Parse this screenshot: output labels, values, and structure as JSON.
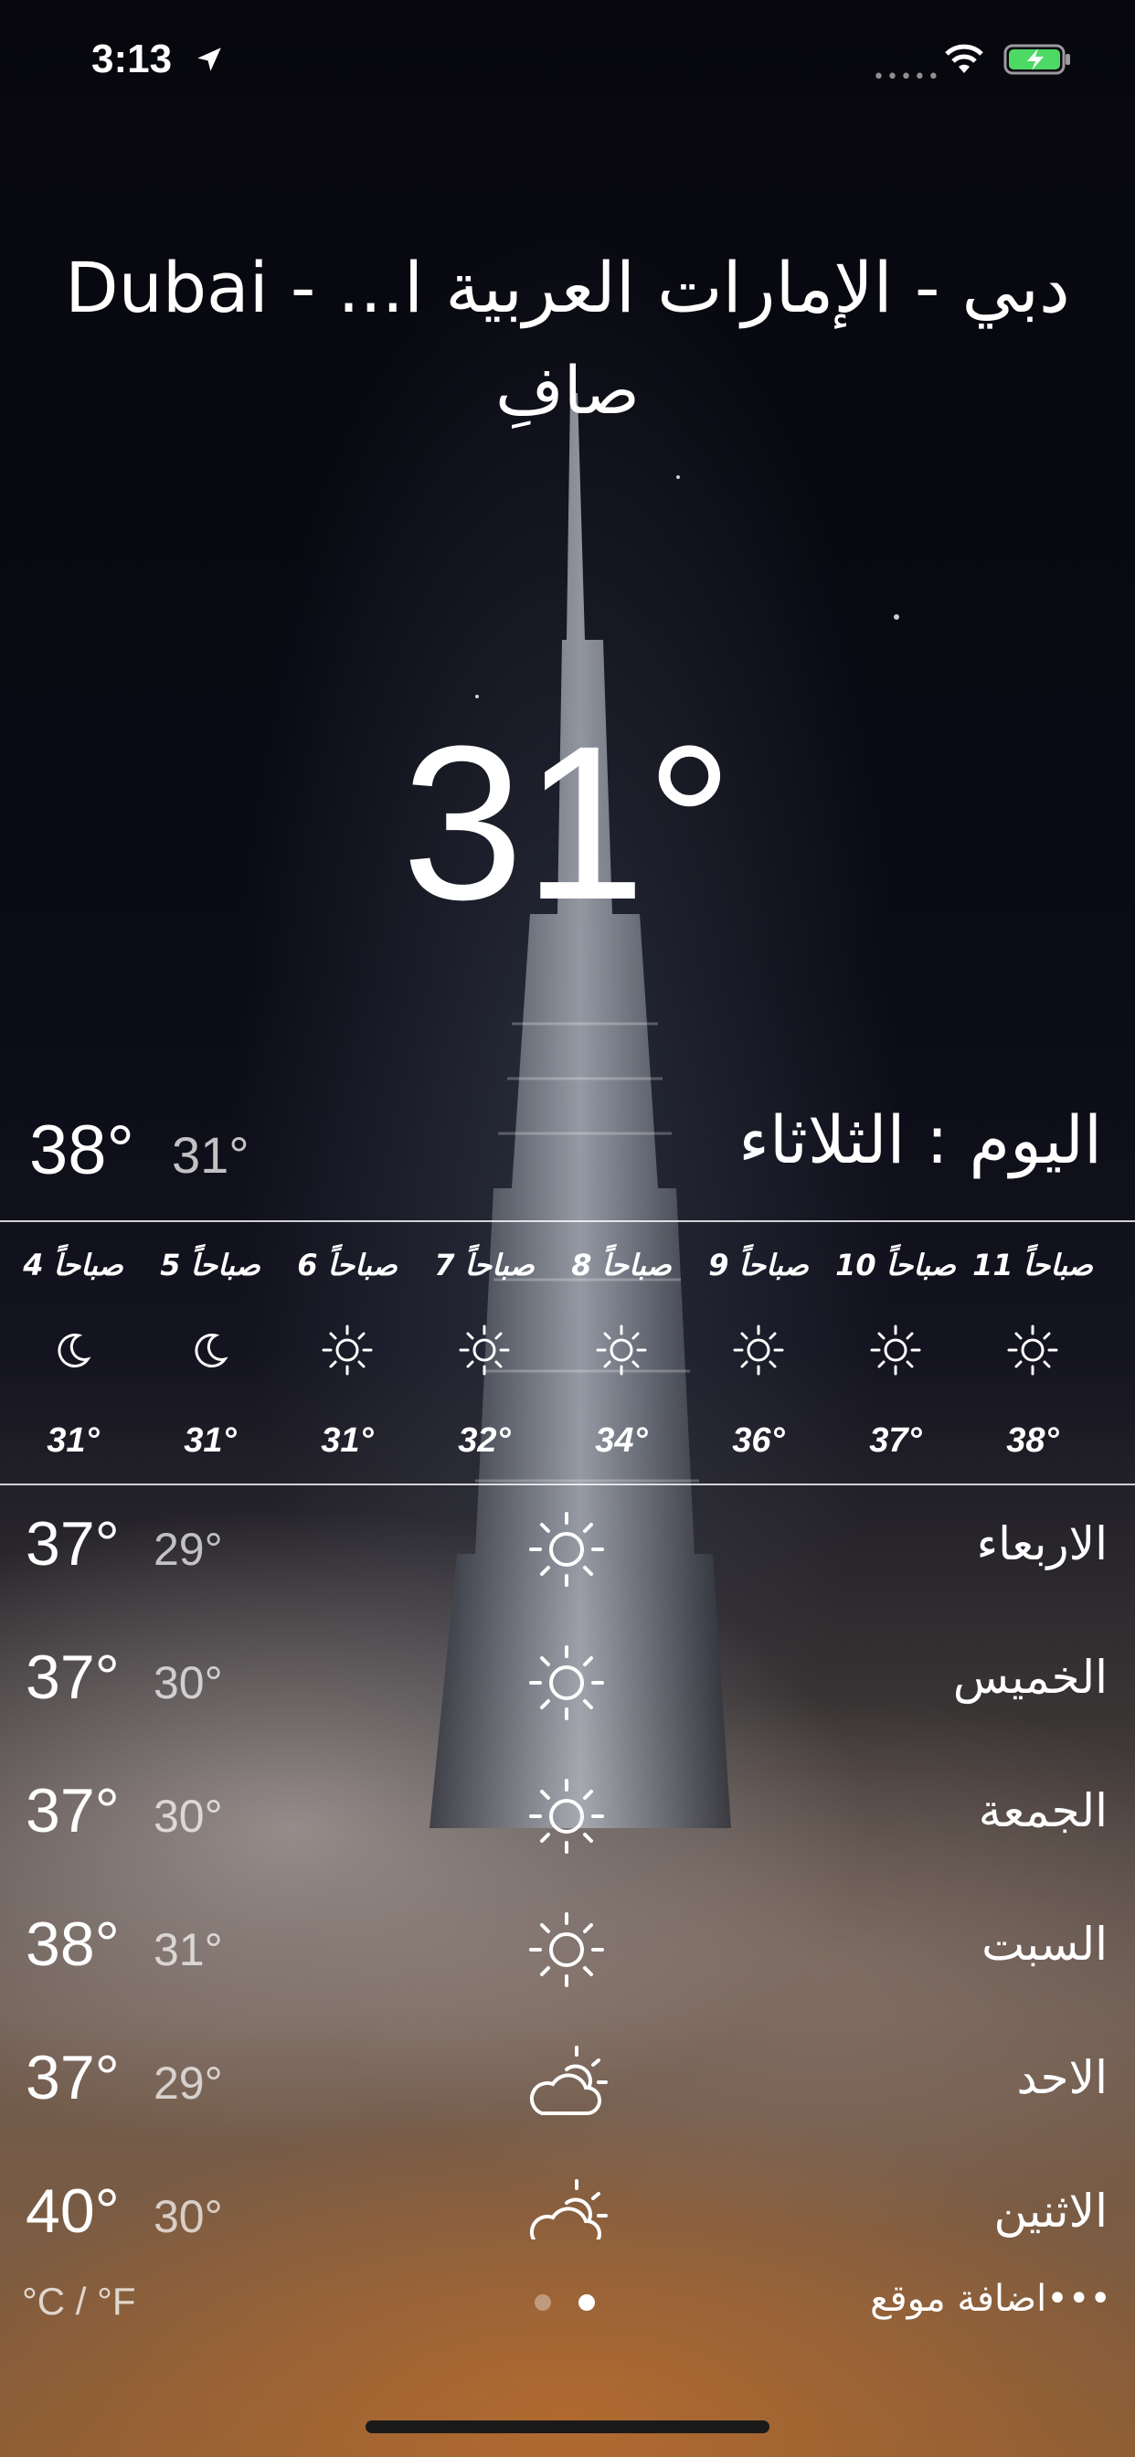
{
  "status_bar": {
    "time": "3:13",
    "signal": "•••••"
  },
  "location": {
    "city": "دبي - الإمارات العربية ا... - Dubai",
    "condition": "صافِ"
  },
  "current_temp": "31°",
  "today": {
    "label": "اليوم : الثلاثاء",
    "high": "38°",
    "low": "31°"
  },
  "hourly": [
    {
      "label": "صباحاً 11",
      "temp": "38°",
      "icon": "sun-icon"
    },
    {
      "label": "صباحاً 10",
      "temp": "37°",
      "icon": "sun-icon"
    },
    {
      "label": "صباحاً 9",
      "temp": "36°",
      "icon": "sun-icon"
    },
    {
      "label": "صباحاً 8",
      "temp": "34°",
      "icon": "sun-icon"
    },
    {
      "label": "صباحاً 7",
      "temp": "32°",
      "icon": "sun-icon"
    },
    {
      "label": "صباحاً 6",
      "temp": "31°",
      "icon": "sun-icon"
    },
    {
      "label": "صباحاً 5",
      "temp": "31°",
      "icon": "moon-icon"
    },
    {
      "label": "صباحاً 4",
      "temp": "31°",
      "icon": "moon-icon"
    }
  ],
  "daily": [
    {
      "day": "الاربعاء",
      "high": "37°",
      "low": "29°",
      "icon": "sun-icon"
    },
    {
      "day": "الخميس",
      "high": "37°",
      "low": "30°",
      "icon": "sun-icon"
    },
    {
      "day": "الجمعة",
      "high": "37°",
      "low": "30°",
      "icon": "sun-icon"
    },
    {
      "day": "السبت",
      "high": "38°",
      "low": "31°",
      "icon": "sun-icon"
    },
    {
      "day": "الاحد",
      "high": "37°",
      "low": "29°",
      "icon": "partly-cloudy-icon"
    },
    {
      "day": "الاثنين",
      "high": "40°",
      "low": "30°",
      "icon": "partly-cloudy-icon"
    }
  ],
  "footer": {
    "units": "°C / °F",
    "add_location": "•••اضافة موقع"
  },
  "page_dots": {
    "count": 2,
    "active": 1
  }
}
